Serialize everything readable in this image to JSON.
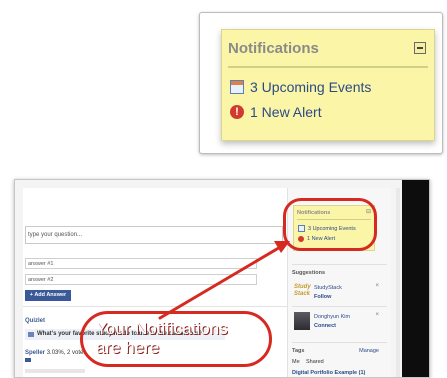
{
  "zoom": {
    "title": "Notifications",
    "events": "3 Upcoming Events",
    "alert": "1 New Alert",
    "alert_glyph": "!"
  },
  "screen": {
    "question_placeholder": "type your question...",
    "answer1": "answer #1",
    "answer2": "answer #2",
    "add_answer": "+ Add Answer",
    "section_title": "Quizlet",
    "quiz_question": "What's your favorite study mode to use in the classroom?",
    "speller_label": "Speller",
    "speller_value": "3.03%, 2 votes",
    "notes": {
      "title": "Notifications",
      "events": "3 Upcoming Events",
      "alert": "1 New Alert"
    },
    "suggestions_title": "Suggestions",
    "suggestion1": {
      "logo": "Study Stack",
      "name": "StudyStack",
      "action": "Follow"
    },
    "suggestion2": {
      "name": "Donghyun Kim",
      "action": "Connect"
    },
    "tags_title": "Tags",
    "manage": "Manage",
    "tag_me": "Me",
    "tag_shared": "Shared",
    "portfolio": "Digital Portfolio Example (1)"
  },
  "callout": {
    "line1": "Your Notifications",
    "line2": "are here",
    "color": "#d62a20"
  }
}
